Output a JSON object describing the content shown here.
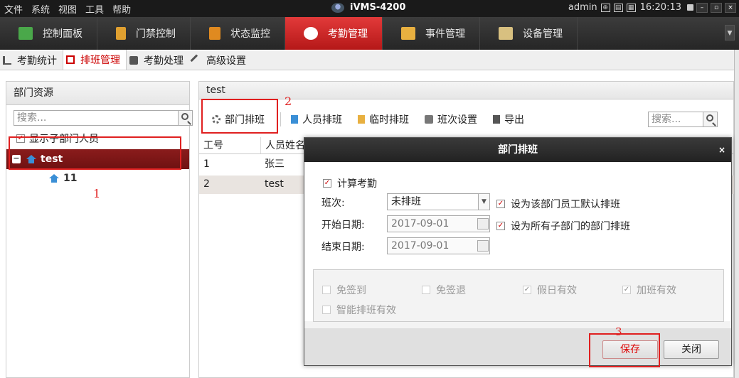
{
  "menubar": {
    "items": [
      "文件",
      "系统",
      "视图",
      "工具",
      "帮助"
    ],
    "app_title": "iVMS-4200",
    "user": "admin",
    "time": "16:20:13"
  },
  "modules": [
    {
      "label": "控制面板",
      "color": "#4aa84a"
    },
    {
      "label": "门禁控制",
      "color": "#e0a030"
    },
    {
      "label": "状态监控",
      "color": "#e08a20"
    },
    {
      "label": "考勤管理",
      "color": "#ffffff"
    },
    {
      "label": "事件管理",
      "color": "#e8b040"
    },
    {
      "label": "设备管理",
      "color": "#d8c080"
    }
  ],
  "subtabs": [
    "考勤统计",
    "排班管理",
    "考勤处理",
    "高级设置"
  ],
  "left_panel": {
    "title": "部门资源",
    "search_placeholder": "搜索...",
    "show_sub_label": "显示子部门人员",
    "tree_root": "test",
    "tree_child": "11",
    "annotation": "1"
  },
  "right_panel": {
    "title": "test",
    "toolbar": [
      "部门排班",
      "人员排班",
      "临时排班",
      "班次设置",
      "导出"
    ],
    "search_placeholder": "搜索...",
    "annotation": "2",
    "columns": [
      "工号",
      "人员姓名"
    ],
    "rows": [
      {
        "id": "1",
        "name": "张三"
      },
      {
        "id": "2",
        "name": "test"
      }
    ]
  },
  "dialog": {
    "title": "部门排班",
    "calc_label": "计算考勤",
    "shift_label": "班次:",
    "shift_value": "未排班",
    "default_label": "设为该部门员工默认排班",
    "start_label": "开始日期:",
    "start_value": "2017-09-01",
    "all_sub_label": "设为所有子部门的部门排班",
    "end_label": "结束日期:",
    "end_value": "2017-09-01",
    "opt_no_checkin": "免签到",
    "opt_no_checkout": "免签退",
    "opt_holiday": "假日有效",
    "opt_overtime": "加班有效",
    "opt_smart": "智能排班有效",
    "save": "保存",
    "close": "关闭",
    "annotation": "3"
  }
}
